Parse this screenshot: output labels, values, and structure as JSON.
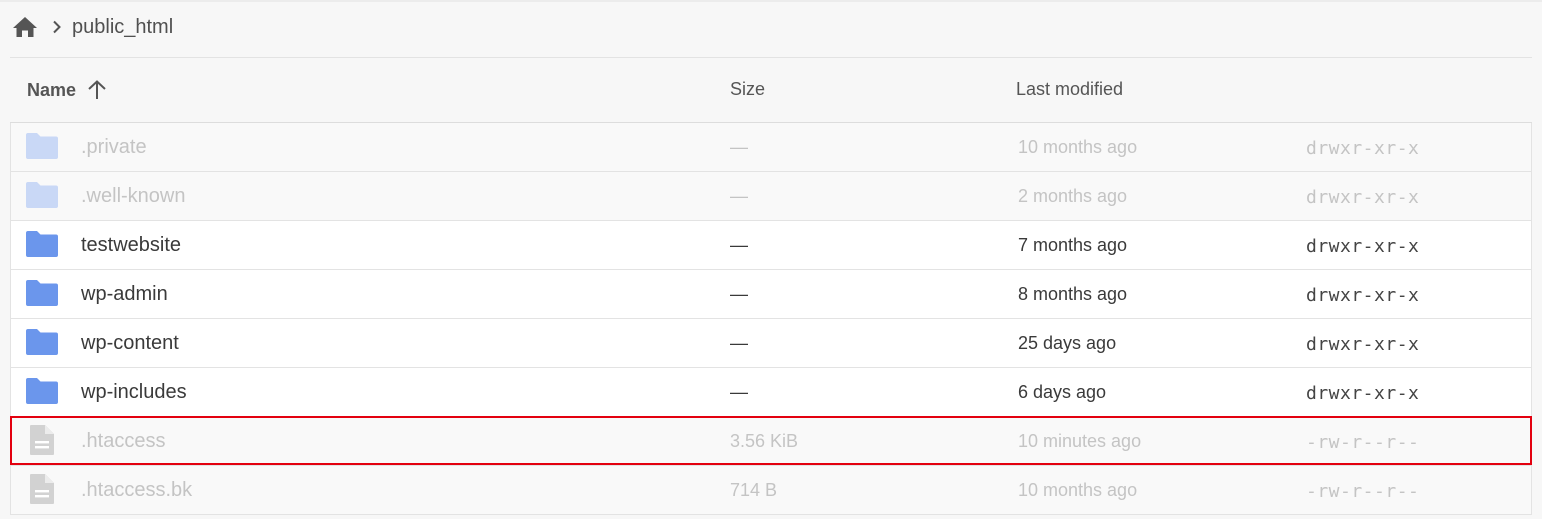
{
  "breadcrumb": {
    "home_icon": "home-icon",
    "current": "public_html"
  },
  "columns": {
    "name": "Name",
    "size": "Size",
    "modified": "Last modified"
  },
  "sort": {
    "column": "name",
    "direction": "ascending",
    "icon": "arrow-up-icon"
  },
  "colors": {
    "folder": "#6b96ec",
    "folder_dim": "#c9d8f6",
    "file_dim": "#d2d2d2",
    "highlight": "#e3000f"
  },
  "files": [
    {
      "name": ".private",
      "size": "—",
      "modified": "10 months ago",
      "perms": "drwxr-xr-x",
      "type": "folder",
      "dimmed": true
    },
    {
      "name": ".well-known",
      "size": "—",
      "modified": "2 months ago",
      "perms": "drwxr-xr-x",
      "type": "folder",
      "dimmed": true
    },
    {
      "name": "testwebsite",
      "size": "—",
      "modified": "7 months ago",
      "perms": "drwxr-xr-x",
      "type": "folder",
      "dimmed": false
    },
    {
      "name": "wp-admin",
      "size": "—",
      "modified": "8 months ago",
      "perms": "drwxr-xr-x",
      "type": "folder",
      "dimmed": false
    },
    {
      "name": "wp-content",
      "size": "—",
      "modified": "25 days ago",
      "perms": "drwxr-xr-x",
      "type": "folder",
      "dimmed": false
    },
    {
      "name": "wp-includes",
      "size": "—",
      "modified": "6 days ago",
      "perms": "drwxr-xr-x",
      "type": "folder",
      "dimmed": false
    },
    {
      "name": ".htaccess",
      "size": "3.56 KiB",
      "modified": "10 minutes ago",
      "perms": "-rw-r--r--",
      "type": "file",
      "dimmed": true,
      "highlighted": true
    },
    {
      "name": ".htaccess.bk",
      "size": "714 B",
      "modified": "10 months ago",
      "perms": "-rw-r--r--",
      "type": "file",
      "dimmed": true
    }
  ]
}
